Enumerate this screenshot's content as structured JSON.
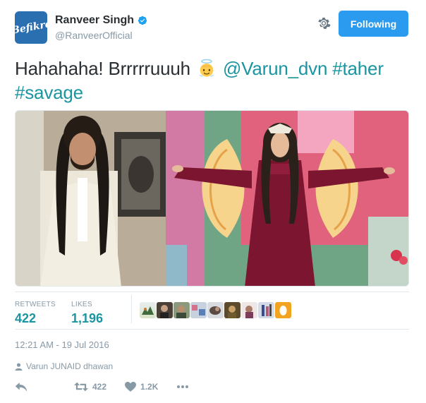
{
  "user": {
    "display_name": "Ranveer Singh",
    "handle": "@RanveerOfficial",
    "avatar_text": "Befikre"
  },
  "header": {
    "follow_label": "Following"
  },
  "tweet": {
    "text_plain": "Hahahaha! Brrrrruuuh",
    "mention": "@Varun_dvn",
    "hashtags": [
      "#taher",
      "#savage"
    ]
  },
  "stats": {
    "retweets_label": "RETWEETS",
    "retweets_value": "422",
    "likes_label": "LIKES",
    "likes_value": "1,196"
  },
  "timestamp": "12:21 AM - 19 Jul 2016",
  "context": "Varun JUNAID dhawan",
  "actions": {
    "retweet_count": "422",
    "like_count": "1.2K"
  },
  "colors": {
    "accent": "#1b95a0",
    "button_blue": "#2b9bf0",
    "muted": "#8899a6"
  }
}
